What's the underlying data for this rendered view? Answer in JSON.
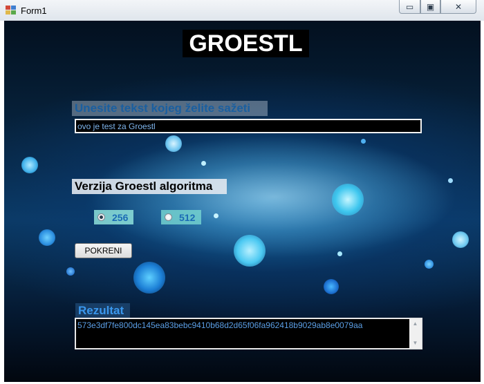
{
  "window": {
    "title": "Form1",
    "controls": {
      "minimize": "▭",
      "maximize": "▣",
      "close": "✕"
    }
  },
  "form": {
    "heading": "GROESTL",
    "input_label": "Unesite tekst kojeg želite sažeti",
    "input_value": "ovo je test za Groestl",
    "version_label": "Verzija Groestl algoritma",
    "options": [
      {
        "label": "256",
        "checked": true
      },
      {
        "label": "512",
        "checked": false
      }
    ],
    "run_button": "POKRENI",
    "result_label": "Rezultat",
    "result_value": "573e3df7fe800dc145ea83bebc9410b68d2d65f06fa962418b9029ab8e0079aa"
  },
  "colors": {
    "heading_bg": "#000000",
    "label_blue": "#1a5fa0",
    "result_text": "#5b9fe6",
    "radio_256_bg": "#96ebe1",
    "radio_512_bg": "#78d7d2"
  },
  "icons": [
    "form-icon",
    "minimize-icon",
    "maximize-icon",
    "close-icon",
    "scroll-up-icon",
    "scroll-down-icon"
  ]
}
